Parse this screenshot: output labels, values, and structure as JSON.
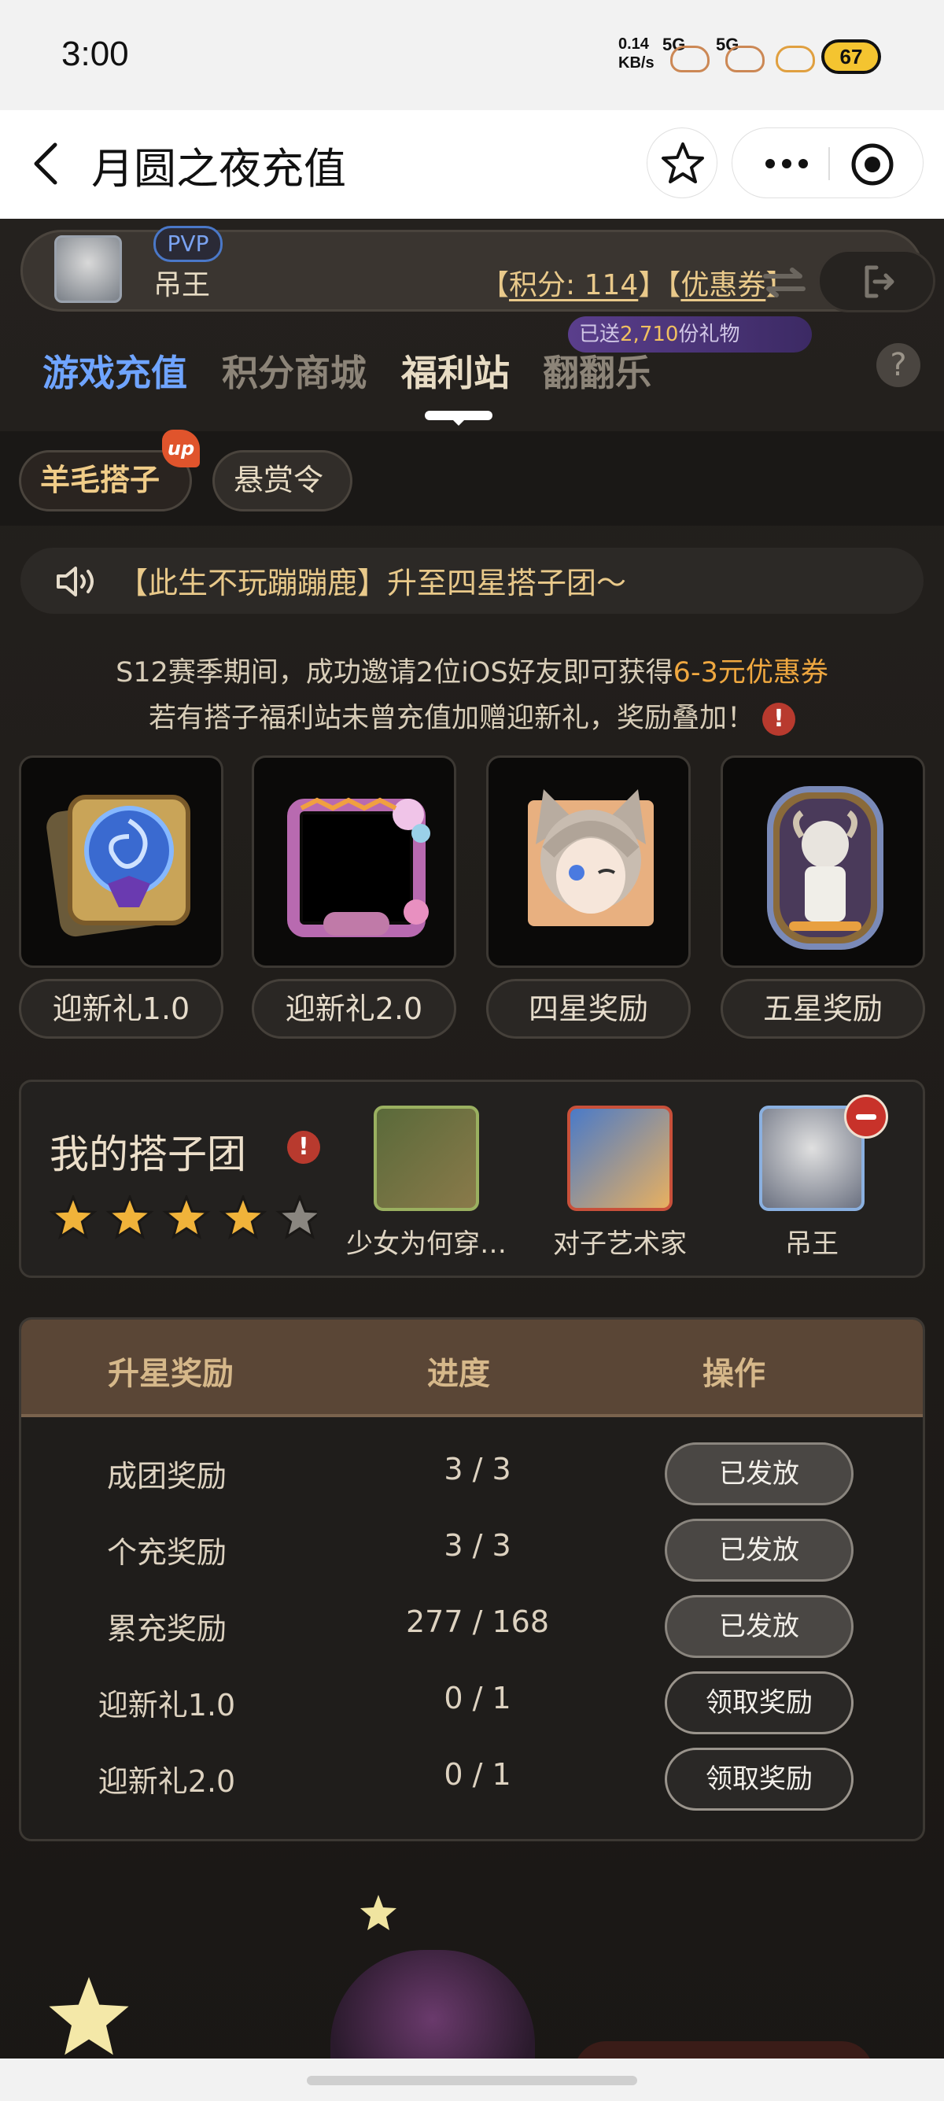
{
  "status_bar": {
    "time": "3:00",
    "net_speed_value": "0.14",
    "net_speed_unit": "KB/s",
    "sig1": "5G",
    "sig2": "5G",
    "battery": "67"
  },
  "nav": {
    "title": "月圆之夜充值"
  },
  "user": {
    "badge": "PVP",
    "name": "吊王",
    "points_open": "【",
    "points_label": "积分: 114",
    "points_mid": "】【",
    "coupon_label": "优惠券",
    "points_close": "】"
  },
  "tabs": {
    "items": [
      "游戏充值",
      "积分商城",
      "福利站",
      "翻翻乐"
    ],
    "active_index": 2
  },
  "gift_badge": {
    "prefix": "已送",
    "count": "2,710",
    "suffix": "份礼物"
  },
  "help_text": "?",
  "sub_tabs": {
    "items": [
      "羊毛搭子",
      "悬赏令"
    ],
    "up_badge": "up"
  },
  "notice": "【此生不玩蹦蹦鹿】升至四星搭子团～",
  "info": {
    "line1_prefix": "S12赛季期间，成功邀请2位iOS好友即可获得",
    "line1_highlight": "6-3元优惠券",
    "line2": "若有搭子福利站未曾充值加赠迎新礼，奖励叠加！",
    "warn_glyph": "!"
  },
  "rewards": [
    {
      "label": "迎新礼1.0",
      "icon": "card-pack-icon"
    },
    {
      "label": "迎新礼2.0",
      "icon": "avatar-frame-icon"
    },
    {
      "label": "四星奖励",
      "icon": "catgirl-avatar-icon"
    },
    {
      "label": "五星奖励",
      "icon": "goat-card-icon"
    }
  ],
  "team": {
    "title": "我的搭子团",
    "warn_glyph": "!",
    "rating": 4,
    "max_rating": 5,
    "members": [
      {
        "name": "少女为何穿…"
      },
      {
        "name": "对子艺术家"
      },
      {
        "name": "吊王"
      }
    ]
  },
  "reward_table": {
    "headers": [
      "升星奖励",
      "进度",
      "操作"
    ],
    "rows": [
      {
        "name": "成团奖励",
        "progress": "3 / 3",
        "action": "已发放",
        "state": "done"
      },
      {
        "name": "个充奖励",
        "progress": "3 / 3",
        "action": "已发放",
        "state": "done"
      },
      {
        "name": "累充奖励",
        "progress": "277 / 168",
        "action": "已发放",
        "state": "done"
      },
      {
        "name": "迎新礼1.0",
        "progress": "0 / 1",
        "action": "领取奖励",
        "state": "claim"
      },
      {
        "name": "迎新礼2.0",
        "progress": "0 / 1",
        "action": "领取奖励",
        "state": "claim"
      }
    ]
  },
  "colors": {
    "active_tab": "#6fa4ff",
    "accent_gold": "#e9c98a",
    "highlight_orange": "#f0a840",
    "warn_red": "#b83a2e"
  }
}
